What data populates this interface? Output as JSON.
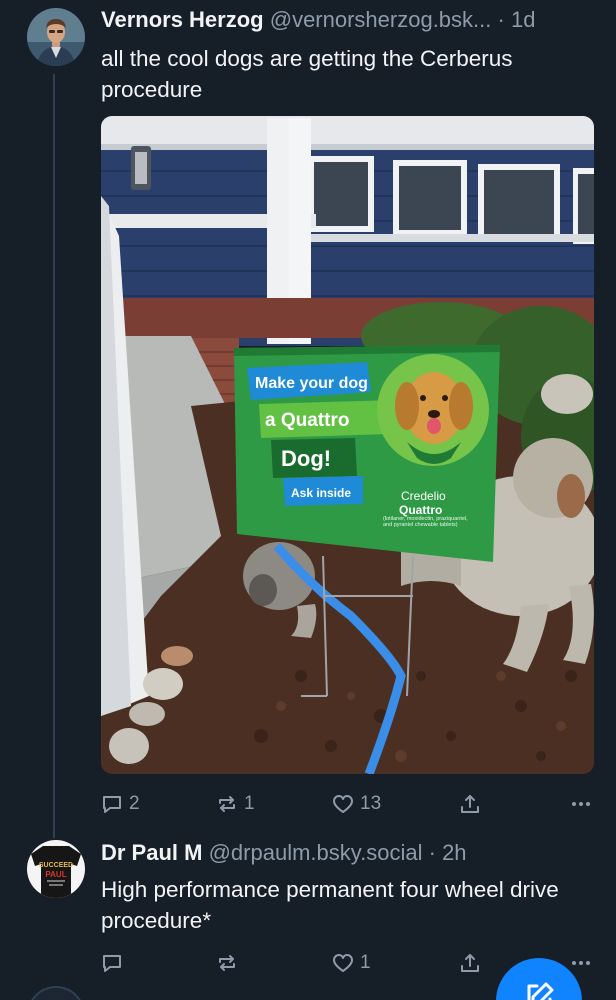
{
  "posts": [
    {
      "name": "Vernors Herzog",
      "handle": "@vernorsherzog.bsk...",
      "separator": "·",
      "time": "1d",
      "text": "all the cool dogs are getting the Cerberus procedure",
      "image": {
        "sign_line1": "Make your dog",
        "sign_line2": "a Quattro",
        "sign_line3": "Dog!",
        "sign_cta": "Ask inside",
        "brand_line1": "Credelio",
        "brand_line2": "Quattro",
        "brand_small": "(lotilaner, moxidectin, praziquantel, and pyrantel chewable tablets)"
      },
      "counts": {
        "replies": "2",
        "reposts": "1",
        "likes": "13"
      }
    },
    {
      "name": "Dr Paul M",
      "handle": "@drpaulm.bsky.social",
      "separator": "·",
      "time": "2h",
      "text": "High performance permanent four wheel drive procedure*",
      "avatar_shirt_text": "SUCCEED",
      "avatar_shirt_name": "PAUL",
      "counts": {
        "replies": "",
        "reposts": "",
        "likes": "1"
      }
    }
  ],
  "colors": {
    "background": "#161e27",
    "muted": "#8d9bab",
    "accent": "#1083fe",
    "sign_green": "#2f9a45",
    "sign_blue": "#1f8ad6"
  },
  "icons": [
    "reply-icon",
    "repost-icon",
    "like-icon",
    "share-icon",
    "more-icon",
    "compose-icon"
  ]
}
